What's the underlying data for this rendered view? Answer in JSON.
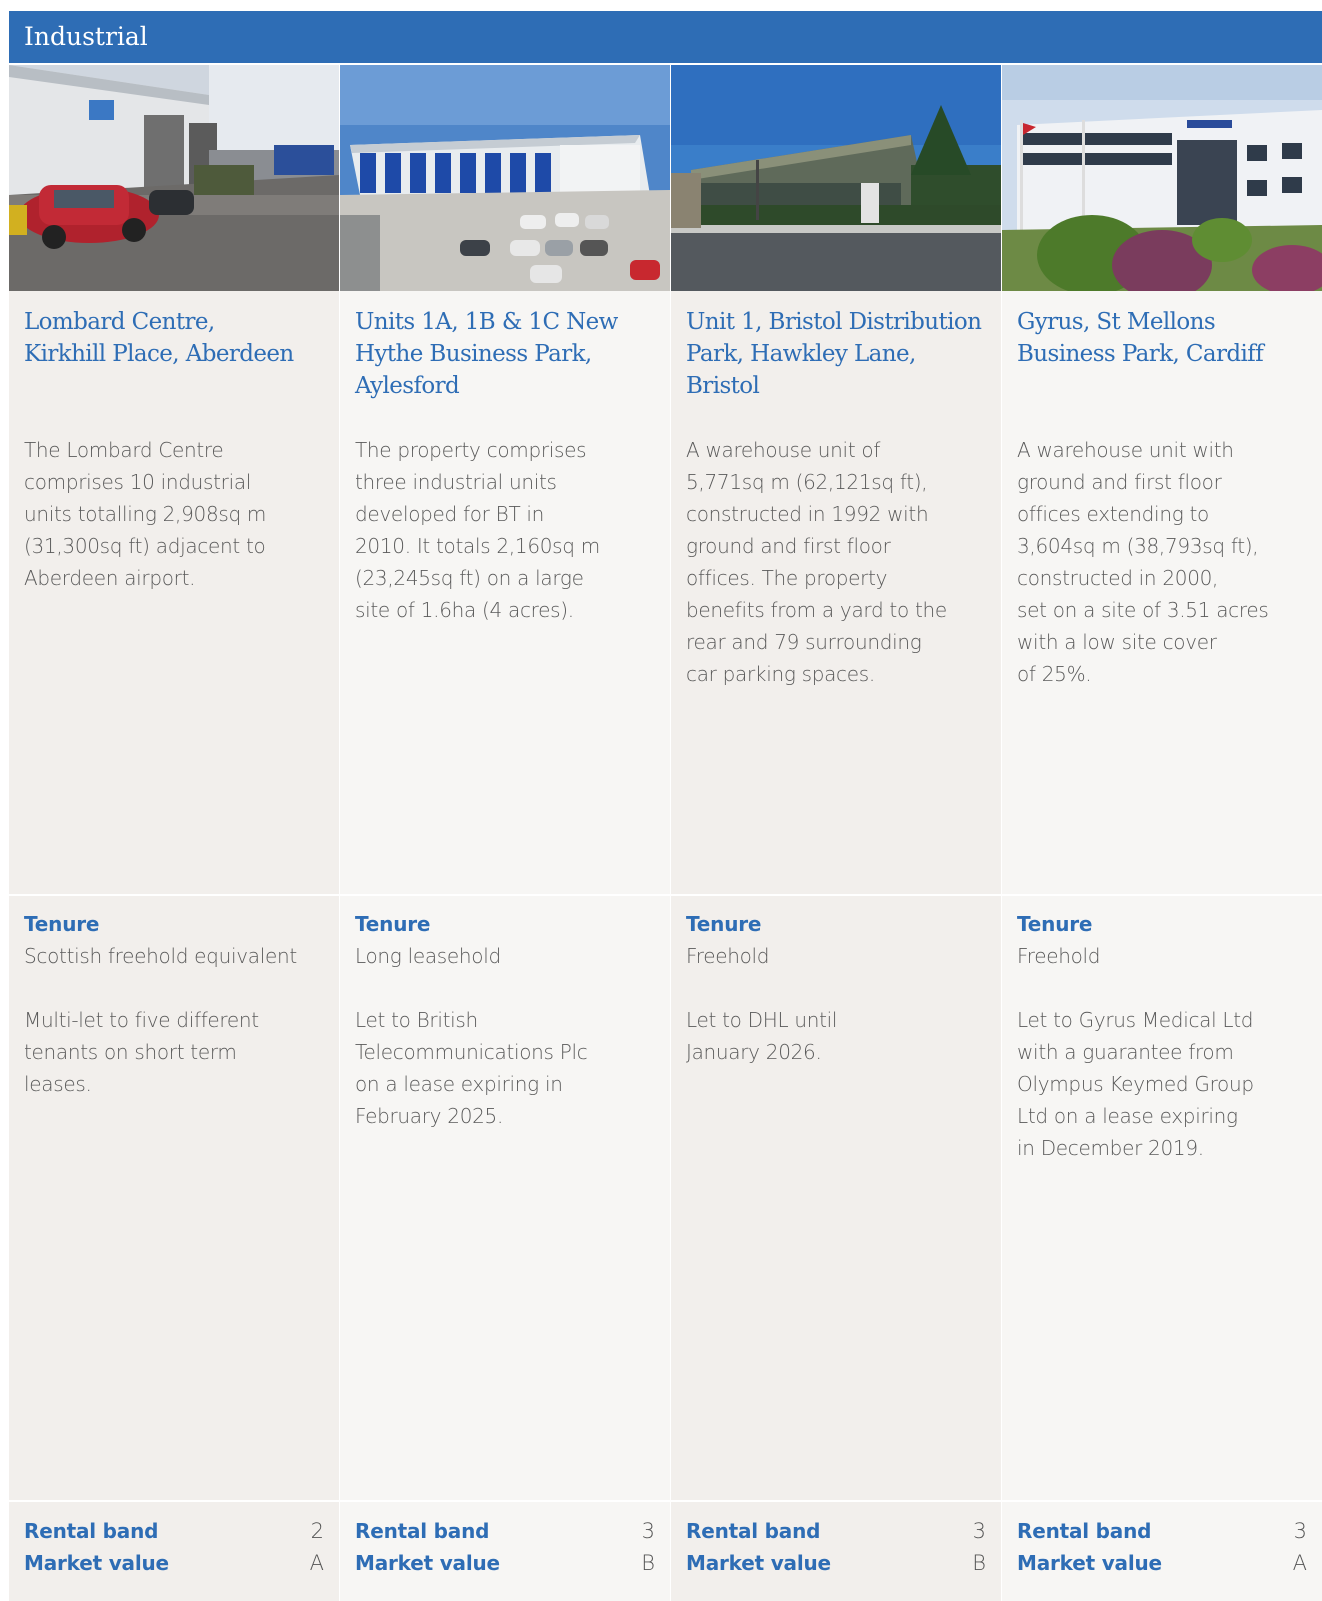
{
  "header": {
    "title": "Industrial"
  },
  "labels": {
    "tenure": "Tenure",
    "rental_band": "Rental band",
    "market_value": "Market value"
  },
  "properties": [
    {
      "title_lines": [
        "Lombard Centre,",
        "Kirkhill Place, Aberdeen"
      ],
      "description_lines": [
        "The Lombard Centre",
        "comprises 10 industrial",
        "units totalling 2,908sq m",
        "(31,300sq ft) adjacent to",
        "Aberdeen airport."
      ],
      "tenure": "Scottish freehold equivalent",
      "lease_lines": [
        "Multi-let to five different",
        "tenants on short term",
        "leases."
      ],
      "rental_band": "2",
      "market_value": "A"
    },
    {
      "title_lines": [
        "Units 1A, 1B & 1C New",
        "Hythe Business Park,",
        "Aylesford"
      ],
      "description_lines": [
        "The property comprises",
        "three industrial units",
        "developed for BT in",
        "2010. It totals 2,160sq m",
        "(23,245sq ft) on a large",
        "site of 1.6ha (4 acres)."
      ],
      "tenure": "Long leasehold",
      "lease_lines": [
        "Let to British",
        "Telecommunications Plc",
        "on a lease expiring in",
        "February 2025."
      ],
      "rental_band": "3",
      "market_value": "B"
    },
    {
      "title_lines": [
        "Unit 1, Bristol Distribution",
        "Park, Hawkley Lane,",
        "Bristol"
      ],
      "description_lines": [
        "A warehouse unit of",
        "5,771sq m (62,121sq ft),",
        "constructed in 1992 with",
        "ground and first floor",
        "offices. The property",
        "benefits from a yard to the",
        "rear and 79 surrounding",
        "car parking spaces."
      ],
      "tenure": "Freehold",
      "lease_lines": [
        "Let to DHL until",
        "January 2026."
      ],
      "rental_band": "3",
      "market_value": "B"
    },
    {
      "title_lines": [
        "Gyrus, St Mellons",
        "Business Park, Cardiff"
      ],
      "description_lines": [
        "A warehouse unit with",
        "ground and first floor",
        "offices extending to",
        "3,604sq m (38,793sq ft),",
        "constructed in 2000,",
        "set on a site of 3.51 acres",
        "with a low site cover",
        "of 25%."
      ],
      "tenure": "Freehold",
      "lease_lines": [
        "Let to Gyrus Medical Ltd",
        "with a guarantee from",
        "Olympus Keymed Group",
        "Ltd on a lease expiring",
        "in December 2019."
      ],
      "rental_band": "3",
      "market_value": "A"
    }
  ],
  "colors": {
    "accent": "#2e6db5",
    "panel_dark": "#f2efec",
    "panel_light": "#f7f6f4"
  }
}
